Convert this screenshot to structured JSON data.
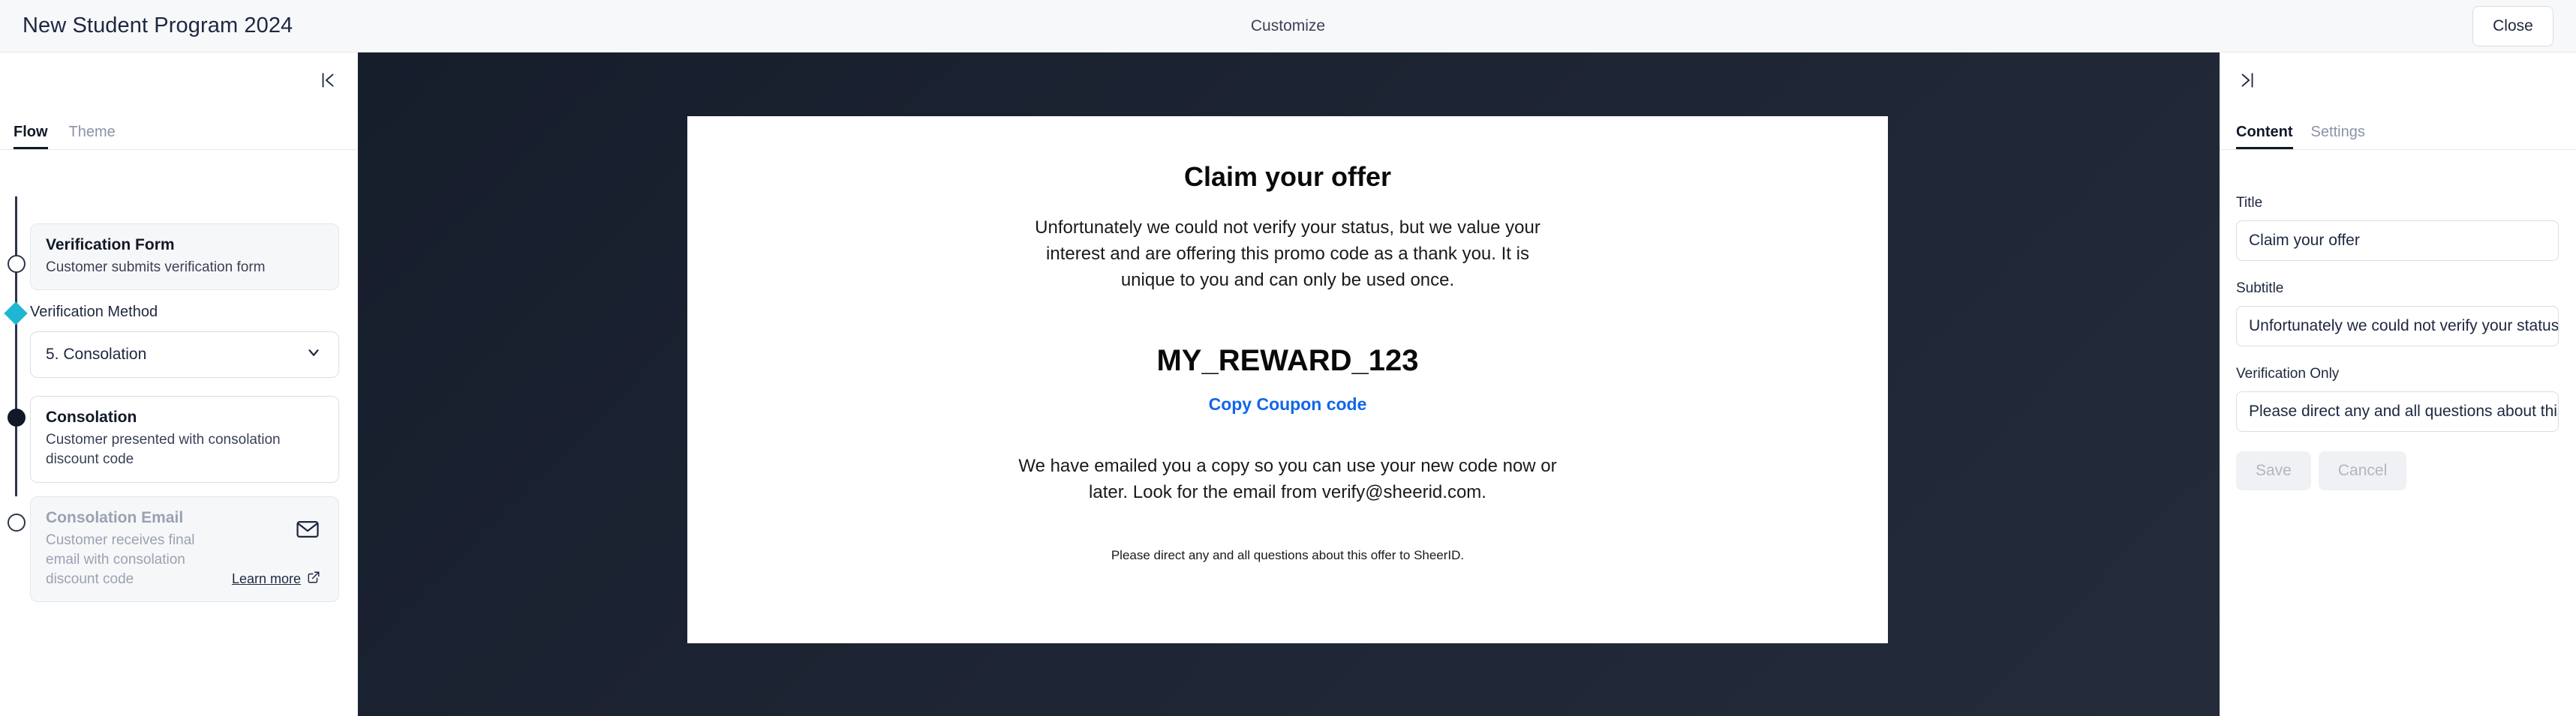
{
  "topbar": {
    "app_title": "New Student Program 2024",
    "center_label": "Customize",
    "close_label": "Close"
  },
  "left_panel": {
    "collapse_icon": "collapse-left-icon",
    "tabs": [
      {
        "label": "Flow",
        "active": true
      },
      {
        "label": "Theme",
        "active": false
      }
    ],
    "steps": [
      {
        "title": "Verification Form",
        "description": "Customer submits verification form"
      },
      {
        "title": "Consolation",
        "description": "Customer presented with consolation discount code"
      },
      {
        "title": "Consolation Email",
        "description": "Customer receives final email with consolation discount code",
        "learn_more": "Learn more",
        "mail_icon": "envelope-icon",
        "external_icon": "external-link-icon"
      }
    ],
    "verification_method": {
      "label": "Verification Method",
      "selected": "5. Consolation",
      "chevron_icon": "chevron-down-icon"
    }
  },
  "preview": {
    "title": "Claim your offer",
    "subtitle": "Unfortunately we could not verify your status, but we value your interest and are offering this promo code as a thank you. It is unique to you and can only be used once.",
    "coupon_code": "MY_REWARD_123",
    "copy_link": "Copy Coupon code",
    "note": "We have emailed you a copy so you can use your new code now or later. Look for the email from verify@sheerid.com.",
    "footer": "Please direct any and all questions about this offer to SheerID.",
    "link_color": "#1167e8"
  },
  "right_panel": {
    "collapse_icon": "collapse-right-icon",
    "tabs": [
      {
        "label": "Content",
        "active": true
      },
      {
        "label": "Settings",
        "active": false
      }
    ],
    "fields": [
      {
        "label": "Title",
        "value": "Claim your offer"
      },
      {
        "label": "Subtitle",
        "value": "Unfortunately we could not verify your status, but we value your interest and are offering this promo code as a thank you."
      },
      {
        "label": "Verification Only",
        "value": "Please direct any and all questions about this offer to SheerID."
      }
    ],
    "buttons": {
      "save": "Save",
      "cancel": "Cancel"
    }
  },
  "colors": {
    "accent_cyan": "#1fb6d4",
    "canvas_dark": "#1d2433",
    "text_dark": "#1e2740"
  }
}
